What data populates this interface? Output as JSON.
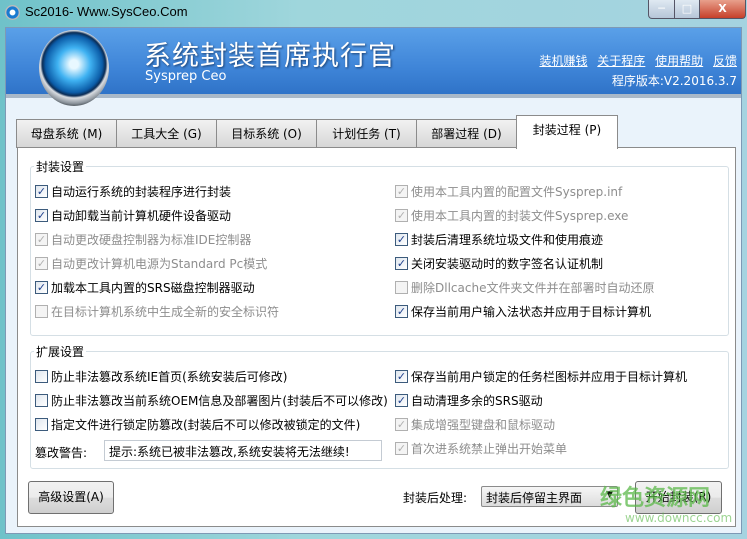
{
  "window": {
    "title": "Sc2016- Www.SysCeo.Com",
    "minimize": "─",
    "maximize": "□",
    "close": "X"
  },
  "header": {
    "title": "系统封装首席执行官",
    "subtitle": "Sysprep  Ceo",
    "links": [
      "装机赚钱",
      "关于程序",
      "使用帮助",
      "反馈"
    ],
    "version": "程序版本:V2.2016.3.7"
  },
  "tabs": [
    {
      "label": "母盘系统 (M)"
    },
    {
      "label": "工具大全 (G)"
    },
    {
      "label": "目标系统 (O)"
    },
    {
      "label": "计划任务 (T)"
    },
    {
      "label": "部署过程 (D)"
    },
    {
      "label": "封装过程 (P)",
      "active": true
    }
  ],
  "seal_settings": {
    "label": "封装设置",
    "left": [
      {
        "label": "自动运行系统的封装程序进行封装",
        "checked": true,
        "enabled": true
      },
      {
        "label": "自动卸载当前计算机硬件设备驱动",
        "checked": true,
        "enabled": true
      },
      {
        "label": "自动更改硬盘控制器为标准IDE控制器",
        "checked": true,
        "enabled": false
      },
      {
        "label": "自动更改计算机电源为Standard Pc模式",
        "checked": true,
        "enabled": false
      },
      {
        "label": "加载本工具内置的SRS磁盘控制器驱动",
        "checked": true,
        "enabled": true
      },
      {
        "label": "在目标计算机系统中生成全新的安全标识符",
        "checked": false,
        "enabled": false
      }
    ],
    "right": [
      {
        "label": "使用本工具内置的配置文件Sysprep.inf",
        "checked": true,
        "enabled": false
      },
      {
        "label": "使用本工具内置的封装文件Sysprep.exe",
        "checked": true,
        "enabled": false
      },
      {
        "label": "封装后清理系统垃圾文件和使用痕迹",
        "checked": true,
        "enabled": true
      },
      {
        "label": "关闭安装驱动时的数字签名认证机制",
        "checked": true,
        "enabled": true
      },
      {
        "label": "删除Dllcache文件夹文件并在部署时自动还原",
        "checked": false,
        "enabled": false
      },
      {
        "label": "保存当前用户输入法状态并应用于目标计算机",
        "checked": true,
        "enabled": true
      }
    ]
  },
  "ext_settings": {
    "label": "扩展设置",
    "left": [
      {
        "label": "防止非法篡改系统IE首页(系统安装后可修改)",
        "checked": false,
        "enabled": true
      },
      {
        "label": "防止非法篡改当前系统OEM信息及部署图片(封装后不可以修改)",
        "checked": false,
        "enabled": true
      },
      {
        "label": "指定文件进行锁定防篡改(封装后不可以修改被锁定的文件)",
        "checked": false,
        "enabled": true
      }
    ],
    "right": [
      {
        "label": "保存当前用户锁定的任务栏图标并应用于目标计算机",
        "checked": true,
        "enabled": true
      },
      {
        "label": "自动清理多余的SRS驱动",
        "checked": true,
        "enabled": true
      },
      {
        "label": "集成增强型键盘和鼠标驱动",
        "checked": true,
        "enabled": false
      },
      {
        "label": "首次进系统禁止弹出开始菜单",
        "checked": true,
        "enabled": false
      }
    ],
    "warning_label": "篡改警告:",
    "warning_value": "提示:系统已被非法篡改,系统安装将无法继续!"
  },
  "footer": {
    "advanced_button": "高级设置(A)",
    "post_label": "封装后处理:",
    "post_select": "封装后停留主界面",
    "start_button": "开始封装(R)"
  },
  "watermark": {
    "text": "绿色资源网",
    "url": "www.downcc.com"
  }
}
